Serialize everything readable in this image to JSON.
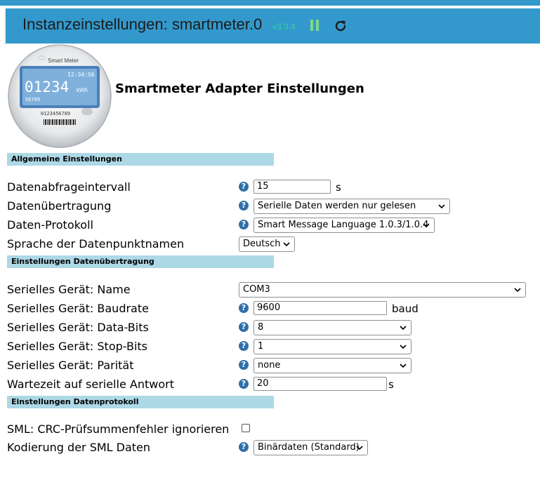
{
  "window": {
    "title": "Instanzeinstellungen: smartmeter.0",
    "version": "v3.3.4",
    "accent_color": "#3399cc",
    "pause_icon": "pause-icon",
    "refresh_icon": "refresh-icon"
  },
  "logo": {
    "brand": "Smart Meter",
    "time": "12:34:56",
    "reading": "01234",
    "unit": "kWh",
    "sub_number": "56789",
    "serial": "0123456789"
  },
  "heading": "Smartmeter Adapter Einstellungen",
  "sections": {
    "general": {
      "title": "Allgemeine Einstellungen",
      "interval_label": "Datenabfrageintervall",
      "interval_value": "15",
      "interval_unit": "s",
      "transmission_label": "Datenübertragung",
      "transmission_value": "Serielle Daten werden nur gelesen",
      "protocol_label": "Daten-Protokoll",
      "protocol_value": "Smart Message Language 1.0.3/1.0.4",
      "language_label": "Sprache der Datenpunktnamen",
      "language_value": "Deutsch"
    },
    "transmission": {
      "title": "Einstellungen Datenübertragung",
      "device_label": "Serielles Gerät: Name",
      "device_value": "COM3",
      "baud_label": "Serielles Gerät: Baudrate",
      "baud_value": "9600",
      "baud_unit": "baud",
      "databits_label": "Serielles Gerät: Data-Bits",
      "databits_value": "8",
      "stopbits_label": "Serielles Gerät: Stop-Bits",
      "stopbits_value": "1",
      "parity_label": "Serielles Gerät: Parität",
      "parity_value": "none",
      "wait_label": "Wartezeit auf serielle Antwort",
      "wait_value": "20",
      "wait_unit": "s"
    },
    "protocol": {
      "title": "Einstellungen Datenprotokoll",
      "crc_label": "SML: CRC-Prüfsummenfehler ignorieren",
      "crc_checked": false,
      "encoding_label": "Kodierung der SML Daten",
      "encoding_value": "Binärdaten (Standard)"
    }
  },
  "help_glyph": "?"
}
